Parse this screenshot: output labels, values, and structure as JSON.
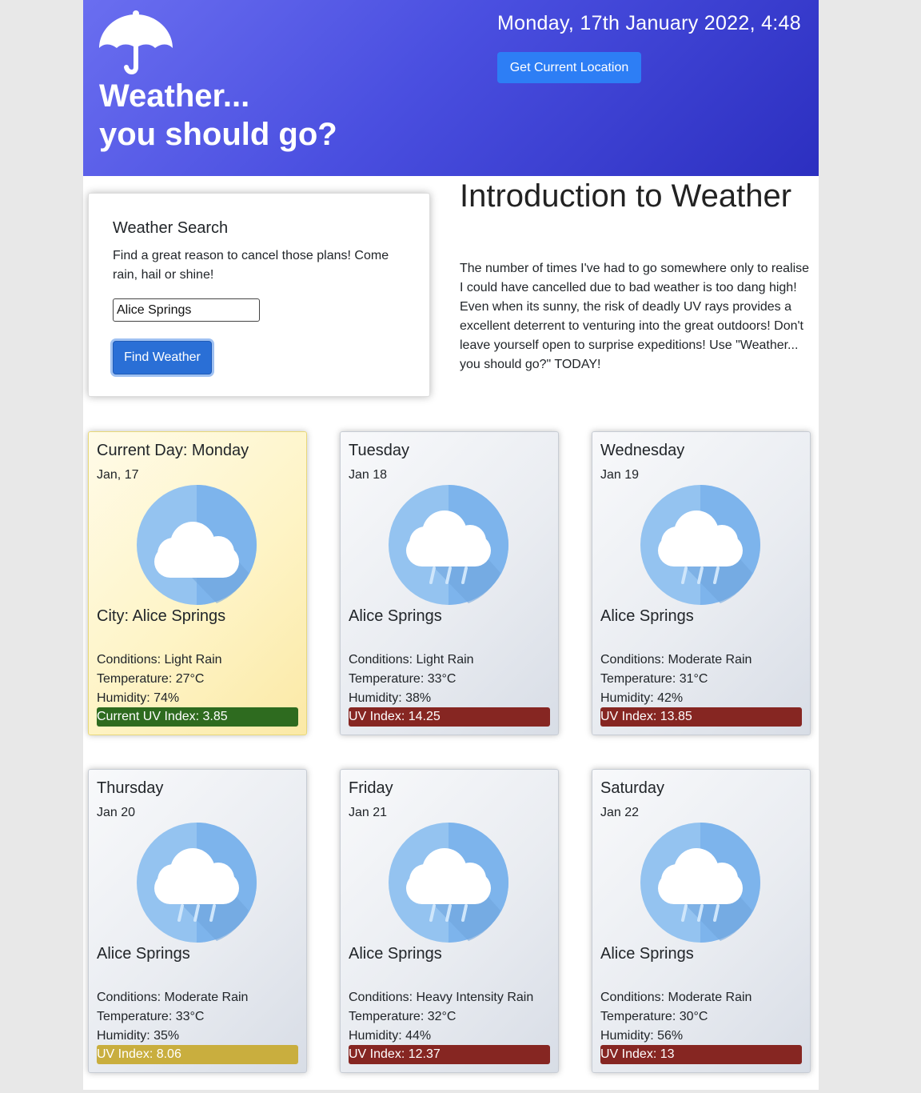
{
  "header": {
    "title_line1": "Weather...",
    "title_line2": "you should go?",
    "datetime": "Monday, 17th January 2022, 4:48",
    "location_button": "Get Current Location",
    "logo_icon": "umbrella-icon"
  },
  "search": {
    "title": "Weather Search",
    "description": "Find a great reason to cancel those plans! Come rain, hail or shine!",
    "input_value": "Alice Springs",
    "button_label": "Find Weather"
  },
  "intro": {
    "title": "Introduction to Weather",
    "text": "The number of times I've had to go somewhere only to realise I could have cancelled due to bad weather is too dang high! Even when its sunny, the risk of deadly UV rays provides a excellent deterrent to venturing into the great outdoors! Don't leave yourself open to surprise expeditions! Use \"Weather... you should go?\" TODAY!"
  },
  "cards": [
    {
      "day": "Current Day: Monday",
      "date": "Jan, 17",
      "city": "City: Alice Springs",
      "icon": "cloud-icon",
      "conditions": "Conditions: Light Rain",
      "temperature": "Temperature: 27°C",
      "humidity": "Humidity: 74%",
      "uv": "Current UV Index: 3.85",
      "uv_color": "#2e6b1f"
    },
    {
      "day": "Tuesday",
      "date": "Jan 18",
      "city": "Alice Springs",
      "icon": "rain-cloud-icon",
      "conditions": "Conditions: Light Rain",
      "temperature": "Temperature: 33°C",
      "humidity": "Humidity: 38%",
      "uv": "UV Index: 14.25",
      "uv_color": "#862622"
    },
    {
      "day": "Wednesday",
      "date": "Jan 19",
      "city": "Alice Springs",
      "icon": "rain-cloud-icon",
      "conditions": "Conditions: Moderate Rain",
      "temperature": "Temperature: 31°C",
      "humidity": "Humidity: 42%",
      "uv": "UV Index: 13.85",
      "uv_color": "#862622"
    },
    {
      "day": "Thursday",
      "date": "Jan 20",
      "city": "Alice Springs",
      "icon": "rain-cloud-icon",
      "conditions": "Conditions: Moderate Rain",
      "temperature": "Temperature: 33°C",
      "humidity": "Humidity: 35%",
      "uv": "UV Index: 8.06",
      "uv_color": "#c9ae3e"
    },
    {
      "day": "Friday",
      "date": "Jan 21",
      "city": "Alice Springs",
      "icon": "rain-cloud-icon",
      "conditions": "Conditions: Heavy Intensity Rain",
      "temperature": "Temperature: 32°C",
      "humidity": "Humidity: 44%",
      "uv": "UV Index: 12.37",
      "uv_color": "#862622"
    },
    {
      "day": "Saturday",
      "date": "Jan 22",
      "city": "Alice Springs",
      "icon": "rain-cloud-icon",
      "conditions": "Conditions: Moderate Rain",
      "temperature": "Temperature: 30°C",
      "humidity": "Humidity: 56%",
      "uv": "UV Index: 13",
      "uv_color": "#862622"
    }
  ]
}
